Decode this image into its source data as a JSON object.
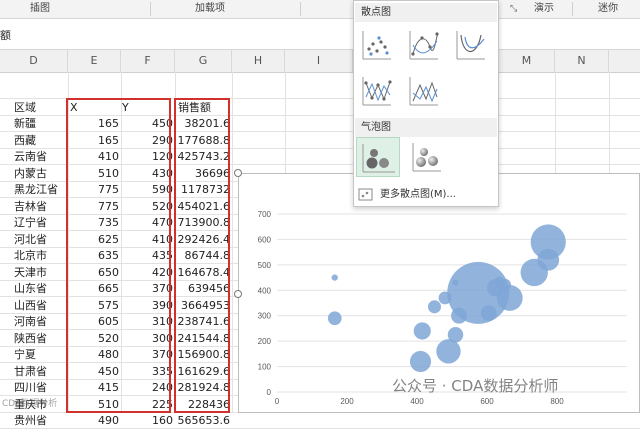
{
  "ribbon": {
    "groups": [
      "插图",
      "加载项",
      "演示",
      "迷你"
    ]
  },
  "formula_bar": {
    "text": "额"
  },
  "columns": [
    "D",
    "E",
    "F",
    "G",
    "H",
    "I",
    "M",
    "N"
  ],
  "sheet": {
    "header": {
      "region": "区域",
      "x": "X",
      "y": "Y",
      "sales": "销售额"
    },
    "rows": [
      {
        "region": "新疆",
        "x": "165",
        "y": "450",
        "sales": "38201.6"
      },
      {
        "region": "西藏",
        "x": "165",
        "y": "290",
        "sales": "177688.8"
      },
      {
        "region": "云南省",
        "x": "410",
        "y": "120",
        "sales": "425743.2"
      },
      {
        "region": "内蒙古",
        "x": "510",
        "y": "430",
        "sales": "36696"
      },
      {
        "region": "黑龙江省",
        "x": "775",
        "y": "590",
        "sales": "1178732"
      },
      {
        "region": "吉林省",
        "x": "775",
        "y": "520",
        "sales": "454021.6"
      },
      {
        "region": "辽宁省",
        "x": "735",
        "y": "470",
        "sales": "713900.8"
      },
      {
        "region": "河北省",
        "x": "625",
        "y": "410",
        "sales": "292426.4"
      },
      {
        "region": "北京市",
        "x": "635",
        "y": "435",
        "sales": "86744.8"
      },
      {
        "region": "天津市",
        "x": "650",
        "y": "420",
        "sales": "164678.4"
      },
      {
        "region": "山东省",
        "x": "665",
        "y": "370",
        "sales": "639456"
      },
      {
        "region": "山西省",
        "x": "575",
        "y": "390",
        "sales": "3664953"
      },
      {
        "region": "河南省",
        "x": "605",
        "y": "310",
        "sales": "238741.6"
      },
      {
        "region": "陕西省",
        "x": "520",
        "y": "300",
        "sales": "241544.8"
      },
      {
        "region": "宁夏",
        "x": "480",
        "y": "370",
        "sales": "156900.8"
      },
      {
        "region": "甘肃省",
        "x": "450",
        "y": "335",
        "sales": "161629.6"
      },
      {
        "region": "四川省",
        "x": "415",
        "y": "240",
        "sales": "281924.8"
      },
      {
        "region": "重庆市",
        "x": "510",
        "y": "225",
        "sales": "228436"
      },
      {
        "region": "贵州省",
        "x": "490",
        "y": "160",
        "sales": "565653.6"
      }
    ]
  },
  "dropdown": {
    "scatter_header": "散点图",
    "bubble_header": "气泡图",
    "more_link": "更多散点图(M)...",
    "scatter_icons": [
      "scatter-markers-icon",
      "scatter-smooth-lines-markers-icon",
      "scatter-smooth-lines-icon",
      "scatter-straight-lines-markers-icon",
      "scatter-straight-lines-icon"
    ],
    "bubble_icons": [
      "bubble-icon",
      "bubble-3d-icon"
    ]
  },
  "chart_data": {
    "type": "scatter",
    "subtype": "bubble",
    "x_ticks": [
      "0",
      "200",
      "400",
      "600",
      "800"
    ],
    "y_ticks": [
      "0",
      "100",
      "200",
      "300",
      "400",
      "500",
      "600",
      "700"
    ],
    "xlim": [
      0,
      1000
    ],
    "ylim": [
      0,
      700
    ],
    "color": "#7fa6d6",
    "points": [
      {
        "x": 165,
        "y": 450,
        "size": 38201.6
      },
      {
        "x": 165,
        "y": 290,
        "size": 177688.8
      },
      {
        "x": 410,
        "y": 120,
        "size": 425743.2
      },
      {
        "x": 510,
        "y": 430,
        "size": 36696
      },
      {
        "x": 775,
        "y": 590,
        "size": 1178732
      },
      {
        "x": 775,
        "y": 520,
        "size": 454021.6
      },
      {
        "x": 735,
        "y": 470,
        "size": 713900.8
      },
      {
        "x": 625,
        "y": 410,
        "size": 292426.4
      },
      {
        "x": 635,
        "y": 435,
        "size": 86744.8
      },
      {
        "x": 650,
        "y": 420,
        "size": 164678.4
      },
      {
        "x": 665,
        "y": 370,
        "size": 639456
      },
      {
        "x": 575,
        "y": 390,
        "size": 3664953
      },
      {
        "x": 605,
        "y": 310,
        "size": 238741.6
      },
      {
        "x": 520,
        "y": 300,
        "size": 241544.8
      },
      {
        "x": 480,
        "y": 370,
        "size": 156900.8
      },
      {
        "x": 450,
        "y": 335,
        "size": 161629.6
      },
      {
        "x": 415,
        "y": 240,
        "size": 281924.8
      },
      {
        "x": 510,
        "y": 225,
        "size": 228436
      },
      {
        "x": 490,
        "y": 160,
        "size": 565653.6
      }
    ]
  },
  "watermark": "公众号 · CDA数据分析师",
  "watermark_small": "CDA数据分析"
}
